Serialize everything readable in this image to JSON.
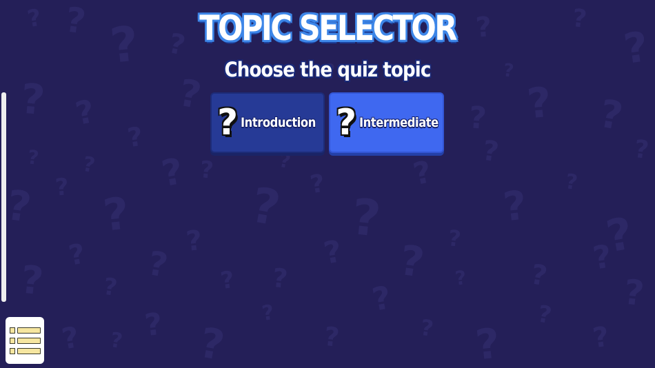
{
  "header": {
    "title": "TOPIC SELECTOR",
    "subtitle": "Choose the quiz topic"
  },
  "topics": [
    {
      "label": "Introduction",
      "icon": "question-mark-icon",
      "selected": false
    },
    {
      "label": "Intermediate",
      "icon": "question-mark-icon",
      "selected": true
    }
  ],
  "glyphs": {
    "question": "?"
  },
  "menu": {
    "icon": "list-menu-icon"
  },
  "colors": {
    "background": "#241f58",
    "title_outline": "#3d86e8",
    "button_default": "#263a96",
    "button_selected": "#3f68f0"
  }
}
